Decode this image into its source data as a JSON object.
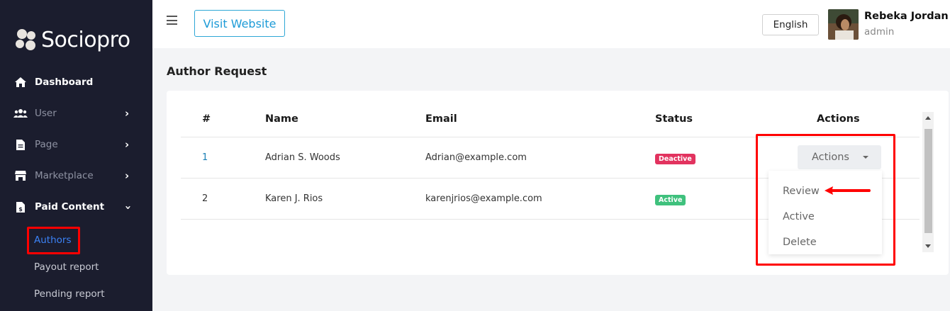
{
  "brand": {
    "name": "Sociopro"
  },
  "sidebar": {
    "items": [
      {
        "label": "Dashboard",
        "icon": "home-icon"
      },
      {
        "label": "User",
        "icon": "users-icon"
      },
      {
        "label": "Page",
        "icon": "file-icon"
      },
      {
        "label": "Marketplace",
        "icon": "store-icon"
      },
      {
        "label": "Paid Content",
        "icon": "paid-file-icon"
      }
    ],
    "subitems": [
      {
        "label": "Authors"
      },
      {
        "label": "Payout report"
      },
      {
        "label": "Pending report"
      }
    ]
  },
  "header": {
    "visit_label": "Visit Website",
    "language": "English",
    "user_name": "Rebeka Jordan",
    "user_role": "admin"
  },
  "page": {
    "title": "Author Request"
  },
  "table": {
    "headers": [
      "#",
      "Name",
      "Email",
      "Status",
      "Actions"
    ],
    "rows": [
      {
        "id": "1",
        "name": "Adrian S. Woods",
        "email": "Adrian@example.com",
        "status": "Deactive"
      },
      {
        "id": "2",
        "name": "Karen J. Rios",
        "email": "karenjrios@example.com",
        "status": "Active"
      }
    ]
  },
  "actions": {
    "button_label": "Actions",
    "menu": [
      "Review",
      "Active",
      "Delete"
    ]
  },
  "colors": {
    "sidebar_bg": "#1b1d2e",
    "accent": "#1d9bd7",
    "deactive": "#e2335f",
    "active": "#3fc17d",
    "highlight": "#ff0000"
  }
}
